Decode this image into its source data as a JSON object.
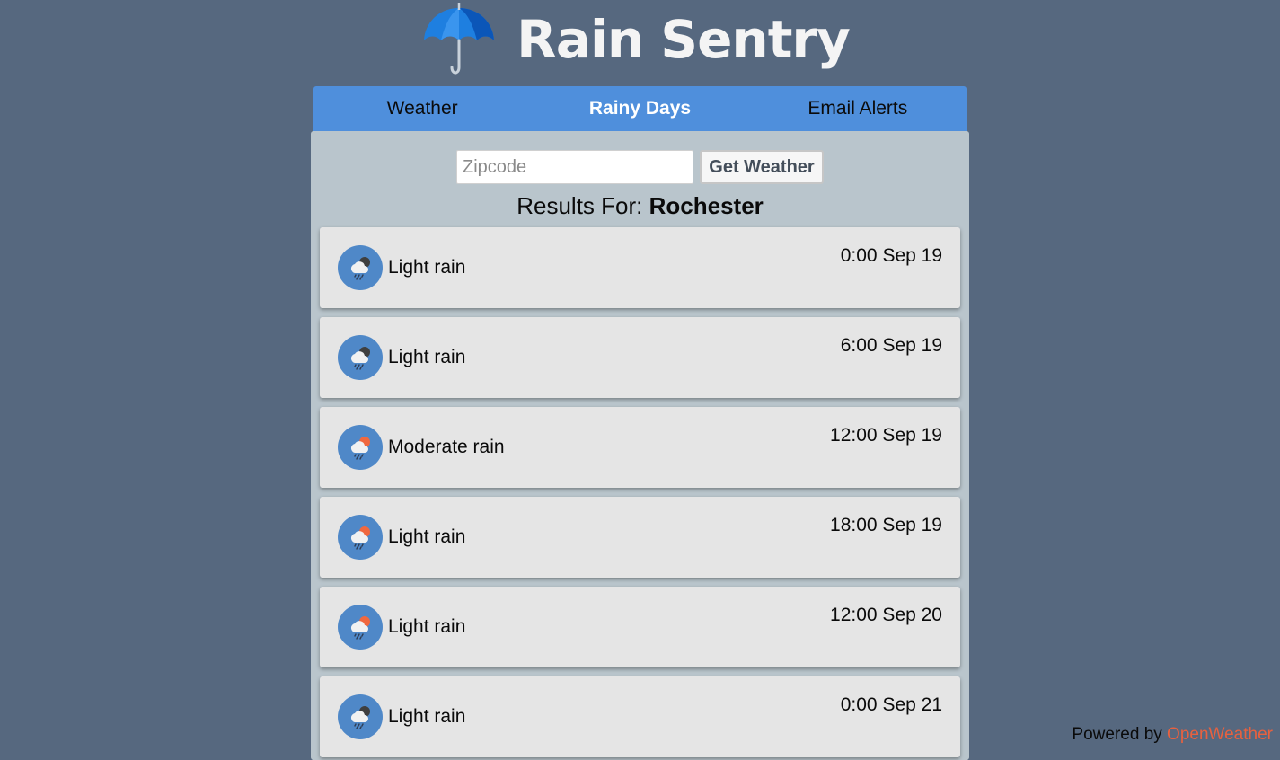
{
  "app": {
    "title": "Rain Sentry"
  },
  "nav": {
    "tabs": [
      {
        "label": "Weather",
        "active": false
      },
      {
        "label": "Rainy Days",
        "active": true
      },
      {
        "label": "Email Alerts",
        "active": false
      }
    ]
  },
  "search": {
    "placeholder": "Zipcode",
    "value": "",
    "button_label": "Get Weather"
  },
  "results": {
    "prefix": "Results For:",
    "city": "Rochester"
  },
  "forecast": [
    {
      "condition": "Light rain",
      "time": "0:00 Sep 19",
      "icon": "night-rain-icon"
    },
    {
      "condition": "Light rain",
      "time": "6:00 Sep 19",
      "icon": "night-rain-icon"
    },
    {
      "condition": "Moderate rain",
      "time": "12:00 Sep 19",
      "icon": "day-rain-icon"
    },
    {
      "condition": "Light rain",
      "time": "18:00 Sep 19",
      "icon": "day-rain-icon"
    },
    {
      "condition": "Light rain",
      "time": "12:00 Sep 20",
      "icon": "day-rain-icon"
    },
    {
      "condition": "Light rain",
      "time": "0:00 Sep 21",
      "icon": "night-rain-icon"
    }
  ],
  "footer": {
    "prefix": "Powered by",
    "brand": "OpenWeather"
  },
  "colors": {
    "background": "#56687f",
    "nav": "#4f8fdc",
    "panel": "#b9c5cc",
    "card": "#e5e5e5",
    "icon_circle": "#4f88c8",
    "brand": "#e8613f"
  }
}
